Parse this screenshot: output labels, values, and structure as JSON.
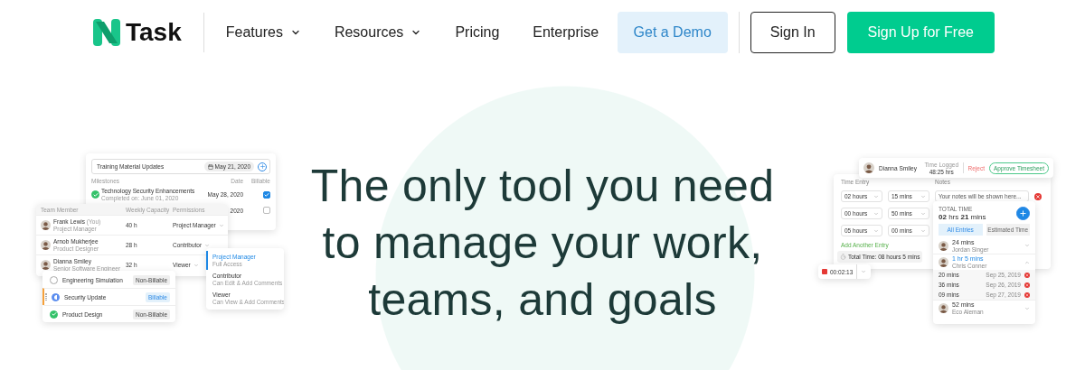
{
  "header": {
    "logo": "Task",
    "nav": [
      {
        "label": "Features",
        "dropdown": true
      },
      {
        "label": "Resources",
        "dropdown": true
      },
      {
        "label": "Pricing",
        "dropdown": false
      },
      {
        "label": "Enterprise",
        "dropdown": false
      }
    ],
    "buttons": [
      {
        "kind": "demo",
        "label": "Get a Demo"
      },
      {
        "kind": "outline",
        "label": "Sign In"
      },
      {
        "kind": "primary",
        "label": "Sign Up for Free"
      }
    ]
  },
  "headline": [
    "The only tool you need",
    "to manage your work,",
    "teams, and goals"
  ],
  "milestones": {
    "task_input": "Training Material Updates",
    "date": "May 21, 2020",
    "columns": [
      "Milestones",
      "Date",
      "Billable"
    ],
    "rows": [
      {
        "title": "Technology Security Enhancements",
        "subtitle": "Completed on: June 01, 2020",
        "date": "May 28, 2020",
        "done": true,
        "billable": true
      },
      {
        "date": "2020",
        "billable": false
      }
    ]
  },
  "team": {
    "columns": [
      "Team Member",
      "Weekly Capacity",
      "Permissions"
    ],
    "members": [
      {
        "name": "Frank Lewis",
        "tag": "(You)",
        "role": "Project Manager",
        "capacity": "40 h",
        "permission": "Project Manager"
      },
      {
        "name": "Arnob Mukherjee",
        "role": "Product Designer",
        "capacity": "28 h",
        "permission": "Contributor"
      },
      {
        "name": "Dianna Smiley",
        "role": "Senior Software Engineer",
        "capacity": "32 h",
        "permission": "Viewer"
      }
    ]
  },
  "permission_menu": [
    {
      "label": "Project Manager",
      "desc": "Full Access",
      "selected": true
    },
    {
      "label": "Contributor",
      "desc": "Can Edit & Add Comments",
      "selected": false
    },
    {
      "label": "Viewer",
      "desc": "Can View & Add Comments",
      "selected": false
    }
  ],
  "tasks": [
    {
      "name": "Engineering Simulation",
      "done": false,
      "in_progress": false,
      "billing": "Non-Billable",
      "billable": false,
      "selected": false
    },
    {
      "name": "Security Update",
      "done": false,
      "in_progress": true,
      "billing": "Billable",
      "billable": true,
      "selected": true
    },
    {
      "name": "Product Design",
      "done": true,
      "in_progress": false,
      "billing": "Non-Billable",
      "billable": false,
      "selected": false
    }
  ],
  "approval": {
    "name": "Dianna Smiley",
    "time_label": "Time Logged",
    "time": "48:25 hrs",
    "reject": "Reject",
    "approve": "Approve Timesheet"
  },
  "time_entry": {
    "label": "Time Entry",
    "notes_label": "Notes",
    "entries": [
      {
        "hours": "02 hours",
        "mins": "15 mins",
        "notes_placeholder": "Your notes will be shown here..."
      },
      {
        "hours": "00 hours",
        "mins": "50 mins"
      },
      {
        "hours": "05 hours",
        "mins": "00 mins"
      }
    ],
    "add_link": "Add Another Entry",
    "total": "Total Time: 08 hours 5 mins"
  },
  "timer": {
    "time": "00:02:13"
  },
  "summary": {
    "label": "TOTAL TIME",
    "total": "**02** hrs **21** mins",
    "tabs": [
      {
        "label": "All Entries",
        "selected": true
      },
      {
        "label": "Estimated Time",
        "selected": false
      }
    ],
    "people": [
      {
        "duration": "24 mins",
        "name": "Jordan Singer",
        "expanded": false
      },
      {
        "duration": "1 hr 5 mins",
        "name": "Chris Conner",
        "expanded": true,
        "entries": [
          {
            "duration": "20 mins",
            "date": "Sep 25, 2019"
          },
          {
            "duration": "36 mins",
            "date": "Sep 26, 2019"
          },
          {
            "duration": "09 mins",
            "date": "Sep 27, 2019"
          }
        ]
      },
      {
        "duration": "52 mins",
        "name": "Eco Aleman",
        "expanded": false
      }
    ]
  }
}
